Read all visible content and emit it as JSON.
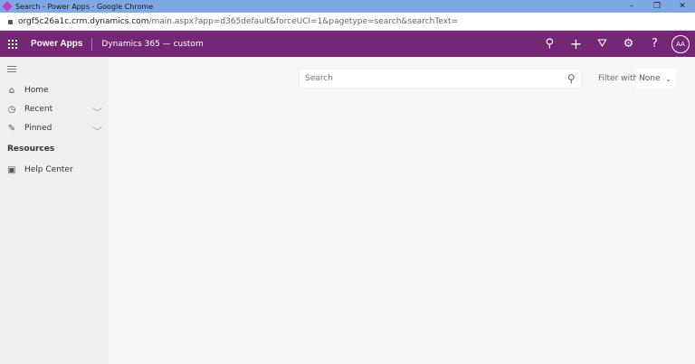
{
  "window": {
    "title": "Search - Power Apps - Google Chrome",
    "minimize": "–",
    "restore": "❐",
    "close": "✕"
  },
  "address": {
    "host": "orgf5c26a1c.crm.dynamics.com",
    "path": "/main.aspx?app=d365default&forceUCI=1&pagetype=search&searchText="
  },
  "nav": {
    "app_name": "Power Apps",
    "environment": "Dynamics 365 — custom",
    "avatar": "AA",
    "icons": {
      "search": "⚲",
      "add": "+",
      "filter": "⛛",
      "settings": "⚙",
      "help": "?"
    },
    "color": "#742774"
  },
  "sidebar": {
    "items": [
      {
        "label": "Home",
        "icon": "⌂"
      },
      {
        "label": "Recent",
        "icon": "◷",
        "chevron": "⌵"
      },
      {
        "label": "Pinned",
        "icon": "✎",
        "chevron": "⌵"
      }
    ],
    "section": "Resources",
    "resources": [
      {
        "label": "Help Center",
        "icon": "▣"
      }
    ]
  },
  "search": {
    "placeholder": "Search",
    "filter_label": "Filter with",
    "filter_value": "None"
  }
}
